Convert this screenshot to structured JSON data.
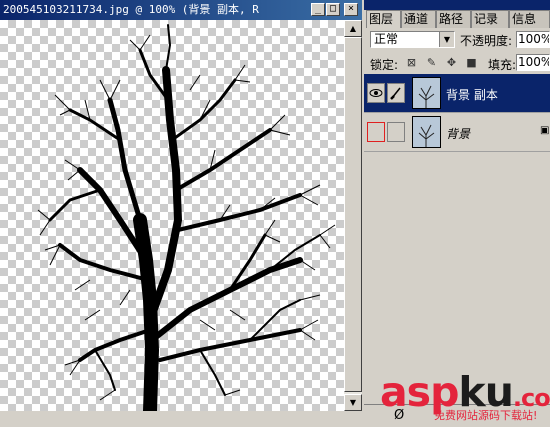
{
  "document": {
    "title": "200545103211734.jpg @ 100% (背景 副本, R",
    "minimize_label": "_",
    "maximize_label": "□",
    "close_label": "×"
  },
  "scrollbar": {
    "up_label": "▲",
    "down_label": "▼"
  },
  "layers_panel": {
    "tabs": [
      "图层",
      "通道",
      "路径",
      "记录",
      "信息"
    ],
    "active_tab": "图层",
    "blend_mode": "正常",
    "opacity_label": "不透明度:",
    "opacity_value": "100%",
    "lock_label": "锁定:",
    "fill_label": "填充:",
    "fill_value": "100%",
    "layers": [
      {
        "name": "背景 副本",
        "selected": true,
        "visible": true
      },
      {
        "name": "背景",
        "selected": false,
        "visible": false,
        "italic": true
      }
    ]
  },
  "watermark": {
    "text_a": "asp",
    "text_b": "ku",
    "text_c": ".com",
    "subtitle": "免费网站源码下载站!"
  },
  "colors": {
    "title_bar": "#0a246a",
    "selected_layer": "#0a246a",
    "brand_red": "#e4243c"
  }
}
